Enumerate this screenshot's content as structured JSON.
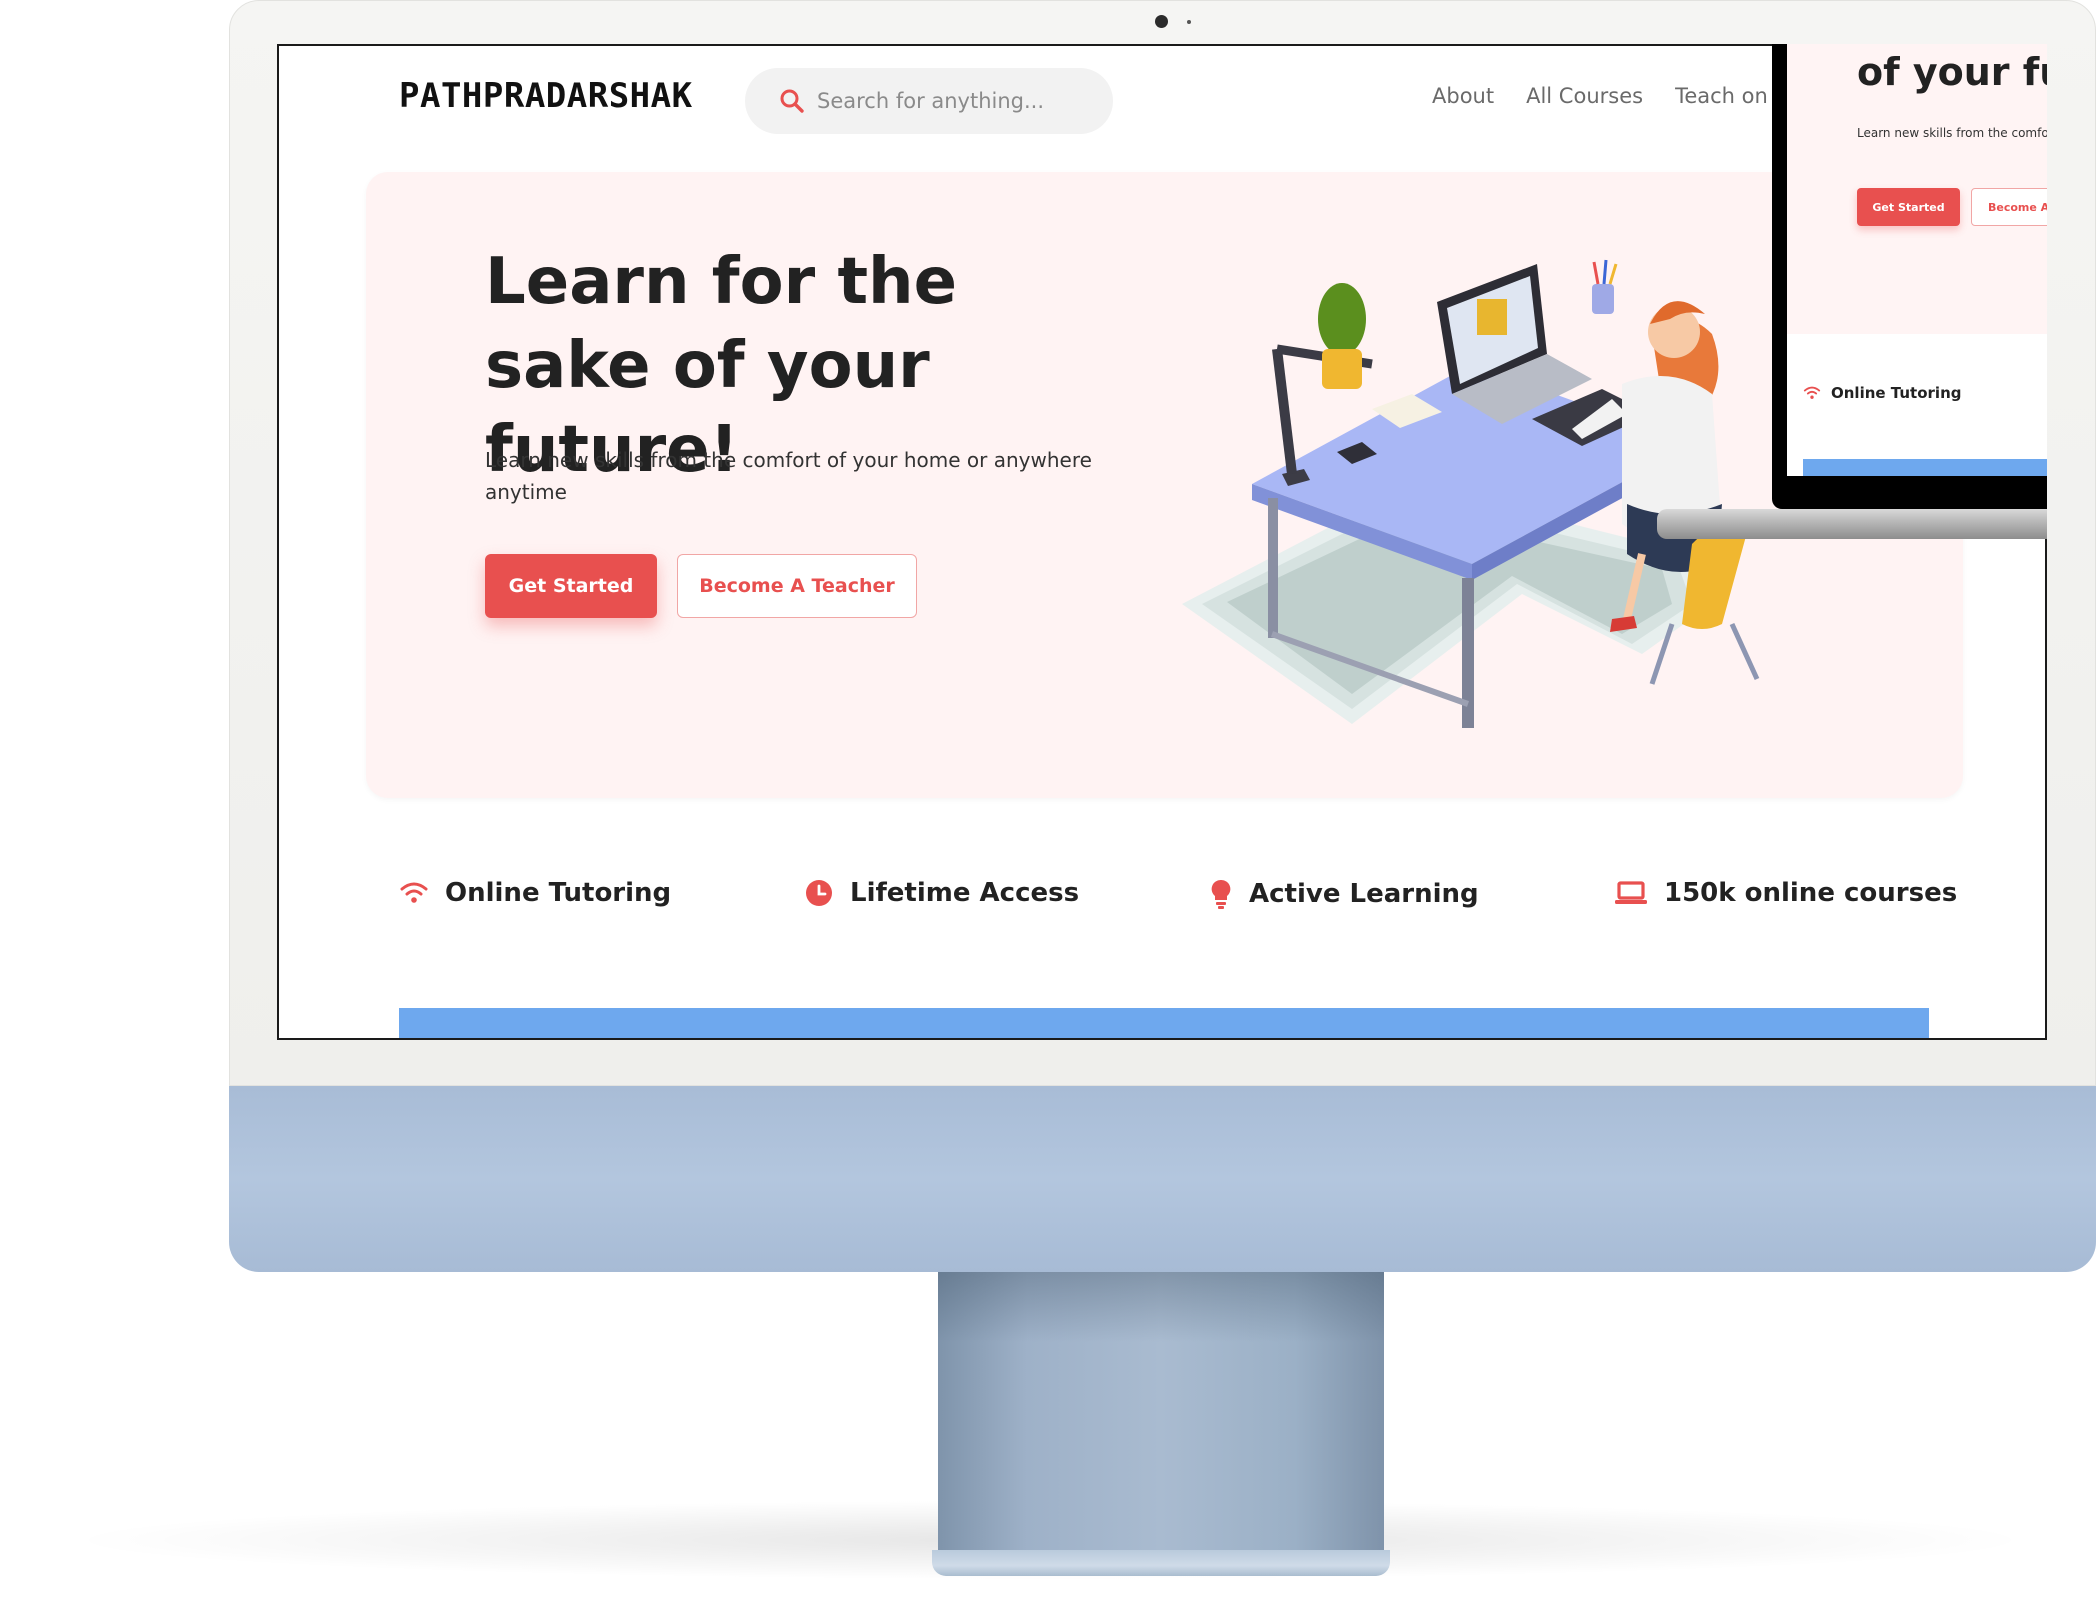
{
  "header": {
    "logo": "PATHPRADARSHAK",
    "search_placeholder": "Search for anything...",
    "nav": [
      "About",
      "All Courses",
      "Teach on"
    ]
  },
  "hero": {
    "title": "Learn for the sake of your future!",
    "subtitle": "Learn new skills from the comfort of your home or anywhere anytime",
    "primary_button": "Get Started",
    "secondary_button": "Become A Teacher"
  },
  "features": [
    {
      "label": "Online Tutoring",
      "icon": "wifi-icon"
    },
    {
      "label": "Lifetime Access",
      "icon": "clock-icon"
    },
    {
      "label": "Active Learning",
      "icon": "lightbulb-icon"
    },
    {
      "label": "150k online courses",
      "icon": "laptop-icon"
    }
  ],
  "laptop_preview": {
    "title": "of your fu",
    "subtitle": "Learn new skills from the comfo anytime",
    "primary_button": "Get Started",
    "secondary_button": "Become A",
    "feature": "Online Tutoring"
  },
  "colors": {
    "accent": "#e8504f",
    "hero_bg": "#fff3f3",
    "blue_bar": "#6ea8ee",
    "imac_chin": "#b3c6de"
  }
}
